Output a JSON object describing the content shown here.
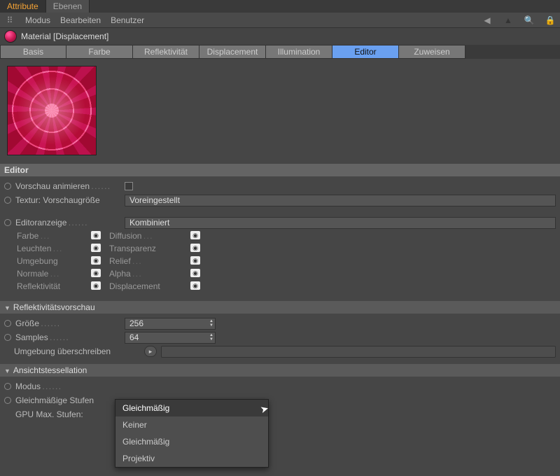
{
  "topTabs": {
    "attribute": "Attribute",
    "ebenen": "Ebenen"
  },
  "menu": {
    "modus": "Modus",
    "bearbeiten": "Bearbeiten",
    "benutzer": "Benutzer"
  },
  "material": {
    "name": "Material [Displacement]"
  },
  "propTabs": {
    "basis": "Basis",
    "farbe": "Farbe",
    "reflekt": "Reflektivität",
    "displacement": "Displacement",
    "illumination": "Illumination",
    "editor": "Editor",
    "zuweisen": "Zuweisen"
  },
  "section": {
    "editor": "Editor",
    "reflect": "Reflektivitätsvorschau",
    "tessel": "Ansichtstessellation"
  },
  "labels": {
    "vorschau": "Vorschau animieren",
    "textur": "Textur: Vorschaugröße",
    "editoranzeige": "Editoranzeige",
    "groesse": "Größe",
    "samples": "Samples",
    "umgebung": "Umgebung überschreiben",
    "modus": "Modus",
    "gleichStufen": "Gleichmäßige Stufen",
    "gpuMax": "GPU Max. Stufen:"
  },
  "values": {
    "textur": "Voreingestellt",
    "editoranzeige": "Kombiniert",
    "groesse": "256",
    "samples": "64",
    "modus": "Gleichmäßig"
  },
  "channels": {
    "farbe": "Farbe",
    "diffusion": "Diffusion",
    "leuchten": "Leuchten",
    "transparenz": "Transparenz",
    "umgebung": "Umgebung",
    "relief": "Relief",
    "normale": "Normale",
    "alpha": "Alpha",
    "reflekt": "Reflektivität",
    "displacement": "Displacement"
  },
  "popup": {
    "gleich": "Gleichmäßig",
    "keiner": "Keiner",
    "gleich2": "Gleichmäßig",
    "projektiv": "Projektiv"
  }
}
